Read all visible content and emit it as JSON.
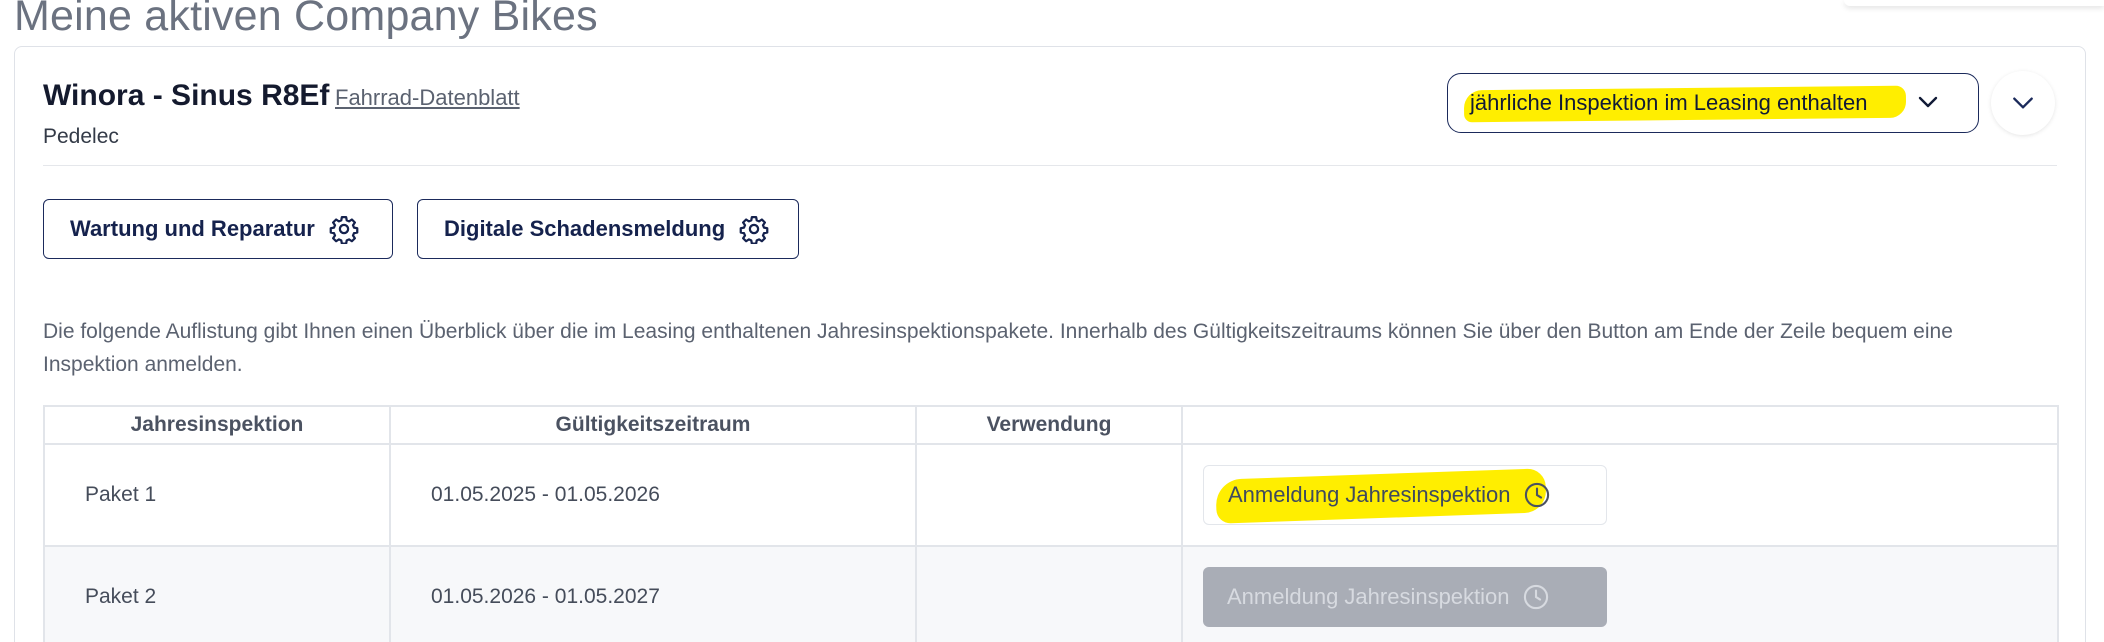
{
  "page": {
    "title": "Meine aktiven Company Bikes"
  },
  "bike": {
    "name": "Winora - Sinus R8Ef",
    "datasheet_link": "Fahrrad-Datenblatt",
    "type": "Pedelec",
    "inspection_select": "jährliche Inspektion im Leasing enthalten"
  },
  "actions": {
    "maintenance": "Wartung und Reparatur",
    "damage_report": "Digitale Schadensmeldung"
  },
  "intro_text": "Die folgende Auflistung gibt Ihnen einen Überblick über die im Leasing enthaltenen Jahresinspektionspakete. Innerhalb des Gültigkeitszeitraums können Sie über den Button am Ende der Zeile bequem eine Inspektion anmelden.",
  "table": {
    "headers": [
      "Jahresinspektion",
      "Gültigkeitszeitraum",
      "Verwendung",
      ""
    ],
    "rows": [
      {
        "package": "Paket 1",
        "period": "01.05.2025 - 01.05.2026",
        "usage": "",
        "button": "Anmeldung Jahresinspektion",
        "enabled": true
      },
      {
        "package": "Paket 2",
        "period": "01.05.2026 - 01.05.2027",
        "usage": "",
        "button": "Anmeldung Jahresinspektion",
        "enabled": false
      }
    ]
  },
  "colors": {
    "primary": "#1b2a5b",
    "highlight": "#ffee00",
    "disabled": "#a9adb6"
  },
  "icons": {
    "select": "chevron-down-icon",
    "collapse": "chevron-down-icon",
    "actions": "gear-icon",
    "register": "clock-icon"
  }
}
